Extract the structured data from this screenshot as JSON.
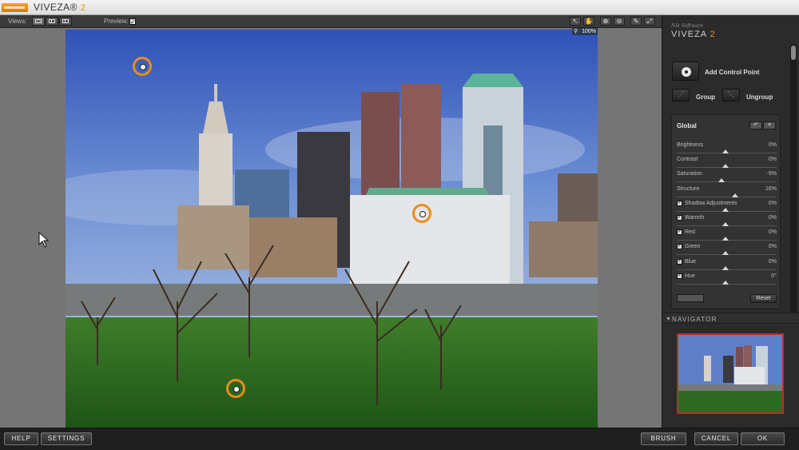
{
  "title_bar": {
    "app_name": "VIVEZA",
    "app_version": "2"
  },
  "toolbar": {
    "views_label": "Views:",
    "preview_label": "Preview:",
    "preview_checked": true
  },
  "canvas": {
    "zoom": "100%"
  },
  "panel": {
    "brand_company": "Nik Software",
    "brand_name": "VIVEZA",
    "brand_version": "2",
    "add_control_point": "Add Control Point",
    "group": "Group",
    "ungroup": "Ungroup",
    "global": {
      "title": "Global",
      "sliders": [
        {
          "name": "Brightness",
          "value": "0%",
          "checkbox": false,
          "level": 0.49
        },
        {
          "name": "Contrast",
          "value": "0%",
          "checkbox": false,
          "level": 0.49
        },
        {
          "name": "Saturation",
          "value": "-9%",
          "checkbox": false,
          "level": 0.45
        },
        {
          "name": "Structure",
          "value": "16%",
          "checkbox": false,
          "level": 0.58
        },
        {
          "name": "Shadow Adjustments",
          "value": "0%",
          "checkbox": true,
          "level": 0.49
        },
        {
          "name": "Warmth",
          "value": "0%",
          "checkbox": true,
          "level": 0.49
        },
        {
          "name": "Red",
          "value": "0%",
          "checkbox": true,
          "level": 0.49
        },
        {
          "name": "Green",
          "value": "0%",
          "checkbox": true,
          "level": 0.49
        },
        {
          "name": "Blue",
          "value": "0%",
          "checkbox": true,
          "level": 0.49
        },
        {
          "name": "Hue",
          "value": "0°",
          "checkbox": true,
          "level": 0.49
        }
      ],
      "reset_label": "Reset"
    },
    "navigator_label": "NAVIGATOR"
  },
  "footer": {
    "help": "HELP",
    "settings": "SETTINGS",
    "brush": "BRUSH",
    "cancel": "CANCEL",
    "ok": "OK"
  },
  "icons": {
    "cursor": "arrow-cursor-icon",
    "control_point": "control-point-icon",
    "add_control_point": "add-control-point-icon"
  },
  "colors": {
    "accent": "#e98c1e",
    "navigator_frame": "#c4282a",
    "version": "#e39218"
  }
}
